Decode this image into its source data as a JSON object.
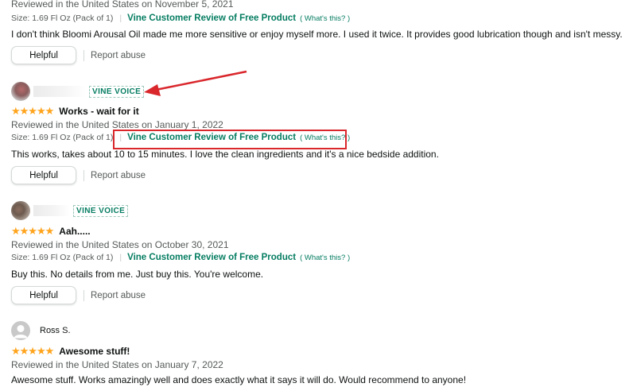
{
  "accent": "#067d62",
  "star_color": "#ffa41c",
  "annotation_color": "#d9272c",
  "reviews": [
    {
      "reviewed": "Reviewed in the United States on November 5, 2021",
      "size": "Size: 1.69 Fl Oz (Pack of 1)",
      "vine_label": "Vine Customer Review of Free Product",
      "whats_this": "( What's this? )",
      "text": "I don't think Bloomi Arousal Oil made me more sensitive or enjoy myself more. I used it twice. It provides good lubrication though and isn't messy.",
      "helpful": "Helpful",
      "report": "Report abuse"
    },
    {
      "badge": "VINE VOICE",
      "rating": 5,
      "stars": "★★★★★",
      "title": "Works - wait for it",
      "reviewed": "Reviewed in the United States on January 1, 2022",
      "size": "Size: 1.69 Fl Oz (Pack of 1)",
      "vine_label": "Vine Customer Review of Free Product",
      "whats_this": "( What's this? )",
      "text": "This works, takes about 10 to 15 minutes. I love the clean ingredients and it's a nice bedside addition.",
      "helpful": "Helpful",
      "report": "Report abuse"
    },
    {
      "badge": "VINE VOICE",
      "rating": 5,
      "stars": "★★★★★",
      "title": "Aah.....",
      "reviewed": "Reviewed in the United States on October 30, 2021",
      "size": "Size: 1.69 Fl Oz (Pack of 1)",
      "vine_label": "Vine Customer Review of Free Product",
      "whats_this": "( What's this? )",
      "text": "Buy this. No details from me. Just buy this. You're welcome.",
      "helpful": "Helpful",
      "report": "Report abuse"
    },
    {
      "author": "Ross S.",
      "rating": 5,
      "stars": "★★★★★",
      "title": "Awesome stuff!",
      "reviewed": "Reviewed in the United States on January 7, 2022",
      "text": "Awesome stuff. Works amazingly well and does exactly what it says it will do. Would recommend to anyone!"
    }
  ]
}
